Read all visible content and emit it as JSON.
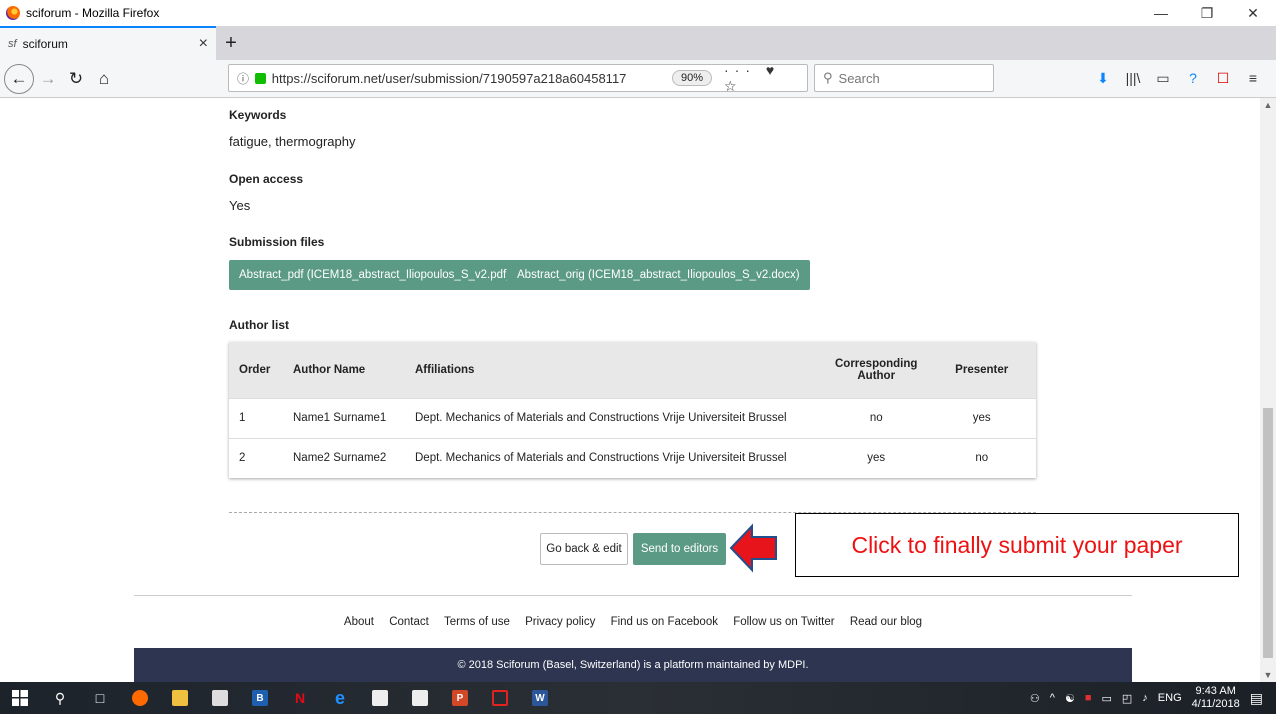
{
  "window": {
    "title": "sciforum - Mozilla Firefox",
    "controls": [
      "—",
      "❐",
      "✕"
    ]
  },
  "tab": {
    "favicon": "sf",
    "title": "sciforum",
    "close": "×",
    "new_tab": "+"
  },
  "nav": {
    "back": "←",
    "forward": "→",
    "reload": "↻",
    "home": "⌂",
    "info": "ⓘ",
    "url": "https://sciforum.net/user/submission/7190597a218a60458117",
    "zoom": "90%",
    "page_actions": "··· ♥ ☆",
    "search_placeholder": "Search",
    "toolbar_icons": [
      "⬇",
      "|||\\",
      "▭",
      "?",
      "☐",
      "≡"
    ]
  },
  "content": {
    "keywords_heading": "Keywords",
    "keywords_value": "fatigue, thermography",
    "open_access_heading": "Open access",
    "open_access_value": "Yes",
    "files_heading": "Submission files",
    "files": [
      "Abstract_pdf (ICEM18_abstract_Iliopoulos_S_v2.pdf)",
      "Abstract_orig (ICEM18_abstract_Iliopoulos_S_v2.docx)"
    ],
    "author_list_heading": "Author list",
    "table_headers": [
      "Order",
      "Author Name",
      "Affiliations",
      "Corresponding Author",
      "Presenter"
    ],
    "rows": [
      [
        "1",
        "Name1 Surname1",
        "Dept. Mechanics of Materials and Constructions Vrije Universiteit Brussel",
        "no",
        "yes"
      ],
      [
        "2",
        "Name2 Surname2",
        "Dept. Mechanics of Materials and Constructions Vrije Universiteit Brussel",
        "yes",
        "no"
      ]
    ],
    "go_back_label": "Go back & edit",
    "send_label": "Send to editors",
    "callout_text": "Click to finally submit your paper"
  },
  "footer": {
    "links": [
      "About",
      "Contact",
      "Terms of use",
      "Privacy policy",
      "Find us on Facebook",
      "Follow us on Twitter",
      "Read our blog"
    ],
    "copyright": "© 2018 Sciforum (Basel, Switzerland) is a platform maintained by MDPI."
  },
  "taskbar": {
    "tray_lang": "ENG",
    "time": "9:43 AM",
    "date": "4/11/2018"
  },
  "colors": {
    "button_green": "#5b9a84",
    "footer_bar": "#2d3550",
    "callout_red": "#ee1111",
    "arrow_red": "#e8141c",
    "arrow_border": "#1f4f8f"
  }
}
